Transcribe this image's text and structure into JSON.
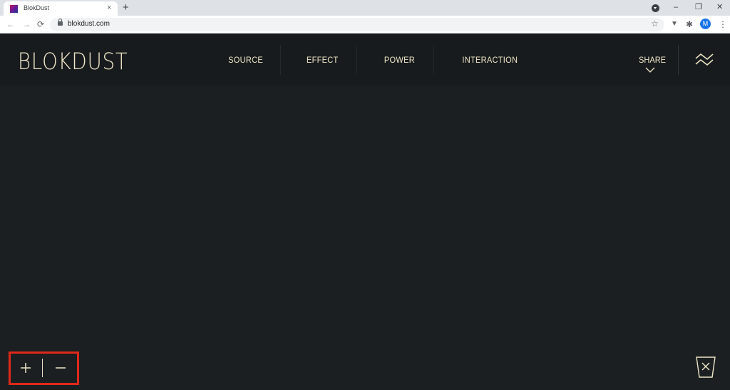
{
  "browser": {
    "tab": {
      "title": "BlokDust",
      "close": "×"
    },
    "new_tab": "+",
    "window_controls": {
      "minimize": "–",
      "restore": "❐",
      "close": "✕"
    },
    "nav": {
      "back": "←",
      "forward": "→",
      "reload": "⟳"
    },
    "url": "blokdust.com",
    "bookmark_star": "☆",
    "profile_initial": "M",
    "menu_dots": "⋮",
    "extension_puzzle": "✱",
    "extension_shield": "▼"
  },
  "app": {
    "logo": "BLOKDUST",
    "menu": [
      {
        "label": "SOURCE"
      },
      {
        "label": "EFFECT"
      },
      {
        "label": "POWER"
      },
      {
        "label": "INTERACTION"
      }
    ],
    "share_label": "SHARE",
    "colors": {
      "background": "#1b1f21",
      "header": "#171b1d",
      "text": "#f0e6c8",
      "highlight": "#e0281a"
    },
    "icons": {
      "zoom_in": "plus-icon",
      "zoom_out": "minus-icon",
      "trash": "trash-icon",
      "menu": "wave-menu-icon"
    }
  }
}
